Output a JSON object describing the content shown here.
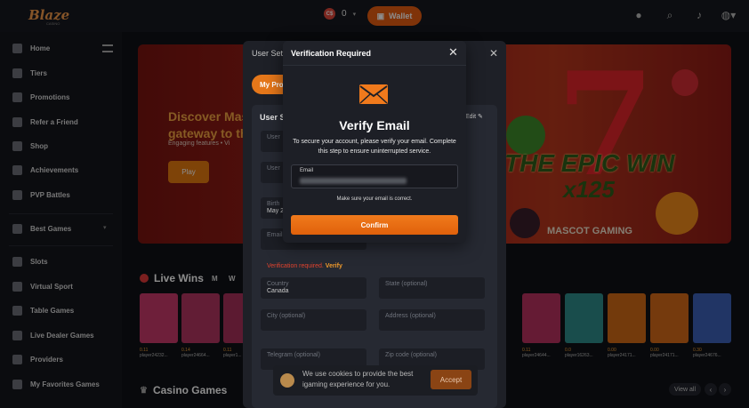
{
  "header": {
    "logo_text": "Blaze",
    "balance": "0",
    "currency_badge": "C$",
    "wallet_label": "Wallet"
  },
  "sidebar": {
    "items": [
      {
        "label": "Home",
        "icon": "home-icon"
      },
      {
        "label": "Tiers",
        "icon": "tiers-icon"
      },
      {
        "label": "Promotions",
        "icon": "gift-icon"
      },
      {
        "label": "Refer a Friend",
        "icon": "refer-icon"
      },
      {
        "label": "Shop",
        "icon": "shop-icon"
      },
      {
        "label": "Achievements",
        "icon": "trophy-icon"
      },
      {
        "label": "PVP Battles",
        "icon": "battle-icon"
      },
      {
        "label": "Best Games",
        "icon": "star-icon"
      },
      {
        "label": "Slots",
        "icon": "slots-icon"
      },
      {
        "label": "Virtual Sport",
        "icon": "virtual-sport-icon"
      },
      {
        "label": "Table Games",
        "icon": "table-games-icon"
      },
      {
        "label": "Live Dealer Games",
        "icon": "live-dealer-icon"
      },
      {
        "label": "Providers",
        "icon": "providers-icon"
      },
      {
        "label": "My Favorites Games",
        "icon": "favorites-icon"
      }
    ]
  },
  "hero": {
    "title_line1": "Discover Mas",
    "title_line2": "gateway to th",
    "subtitle": "Engaging features • Vi",
    "play_label": "Play",
    "banner_text1": "THE EPIC WIN",
    "banner_text2": "x125",
    "banner_brand": "MASCOT GAMING",
    "banner_digit": "7"
  },
  "live_wins": {
    "title": "Live Wins",
    "tabs": [
      "M",
      "W"
    ],
    "tiles_left": [
      {
        "amount": "0.11",
        "player": "player24232...",
        "color": "#c83a6a"
      },
      {
        "amount": "0.14",
        "player": "player24664...",
        "color": "#b23561"
      },
      {
        "amount": "0.11",
        "player": "player1...",
        "color": "#a8305a"
      }
    ],
    "tiles_right": [
      {
        "amount": "0.11",
        "player": "player24644...",
        "color": "#b8325f"
      },
      {
        "amount": "0.0",
        "player": "player16263...",
        "color": "#2e8c8a"
      },
      {
        "amount": "0.00",
        "player": "player24171...",
        "color": "#d26a16"
      },
      {
        "amount": "0.00",
        "player": "player24171...",
        "color": "#d66a18"
      },
      {
        "amount": "0.30",
        "player": "player24676...",
        "color": "#3d62b8"
      }
    ]
  },
  "casino": {
    "title": "Casino Games",
    "view_all": "View all"
  },
  "user_settings": {
    "title": "User Sett",
    "tab_label": "My Pro",
    "section": "User S",
    "edit": "Edit",
    "fields": [
      {
        "label": "User",
        "value": ""
      },
      {
        "label": "User",
        "value": ""
      },
      {
        "label": "Birth",
        "value": "May 2..."
      },
      {
        "label": "Email",
        "value": ""
      },
      {
        "label": "Country",
        "value": "Canada"
      },
      {
        "label": "State (optional)",
        "value": ""
      },
      {
        "label": "City (optional)",
        "value": ""
      },
      {
        "label": "Address (optional)",
        "value": ""
      },
      {
        "label": "Telegram (optional)",
        "value": ""
      },
      {
        "label": "Zip code (optional)",
        "value": ""
      }
    ],
    "verification_note": "Verification required.",
    "verification_link": "Verify"
  },
  "verify_modal": {
    "title": "Verification Required",
    "heading": "Verify Email",
    "description": "To secure your account, please verify your email. Complete this step to ensure uninterrupted service.",
    "email_label": "Email",
    "hint": "Make sure your email is correct.",
    "confirm_label": "Confirm",
    "accent_color": "#f07a1c"
  },
  "cookie": {
    "text": "We use cookies to provide the best igaming experience for you.",
    "accept_label": "Accept"
  }
}
